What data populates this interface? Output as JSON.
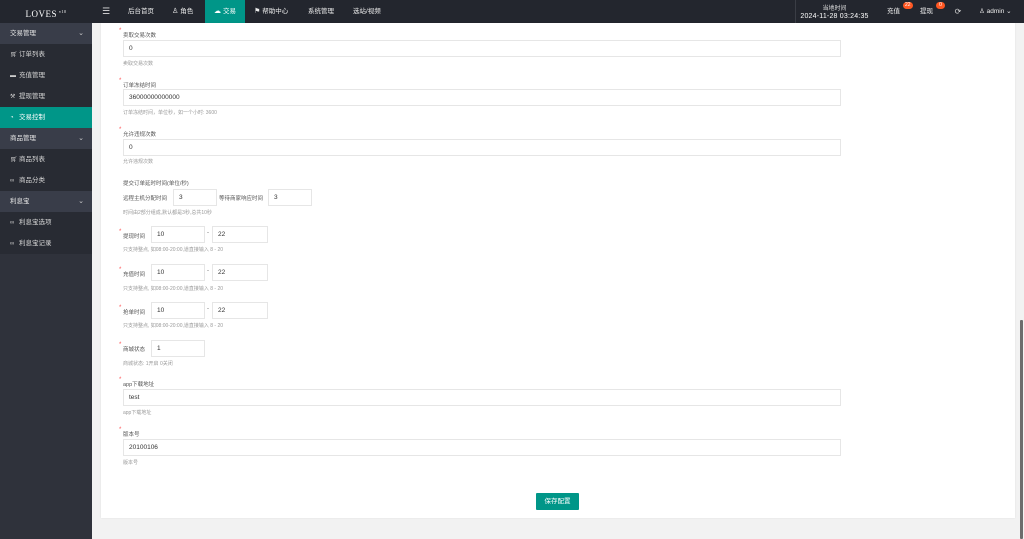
{
  "app": {
    "logo": "LOVES",
    "logo_sup": "v10"
  },
  "topnav": [
    {
      "label": "后台首页",
      "icon": ""
    },
    {
      "label": "角色",
      "icon": "user-icon"
    },
    {
      "label": "交易",
      "icon": "cloud-icon",
      "active": true
    },
    {
      "label": "帮助中心",
      "icon": "flag-icon"
    },
    {
      "label": "系统管理",
      "icon": ""
    },
    {
      "label": "选站/视频",
      "icon": ""
    }
  ],
  "header": {
    "time_label": "当地时间",
    "time_value": "2024-11-28 03:24:35",
    "recharge_label": "充值",
    "recharge_badge": "22",
    "withdraw_label": "提现",
    "withdraw_badge": "0",
    "user_label": "admin"
  },
  "sidebar": {
    "groups": [
      {
        "label": "交易管理",
        "items": [
          {
            "label": "订单列表",
            "icon": "cart-icon"
          },
          {
            "label": "充值管理",
            "icon": "chat-icon"
          },
          {
            "label": "提现管理",
            "icon": "hammer-icon"
          },
          {
            "label": "交易控制",
            "icon": "gauge-icon",
            "active": true
          }
        ]
      },
      {
        "label": "商品管理",
        "items": [
          {
            "label": "商品列表",
            "icon": "cart-icon"
          },
          {
            "label": "商品分类",
            "icon": "link-icon"
          }
        ]
      },
      {
        "label": "利息宝",
        "items": [
          {
            "label": "利息宝选项",
            "icon": "link-icon"
          },
          {
            "label": "利息宝记录",
            "icon": "link-icon"
          }
        ]
      }
    ]
  },
  "form": {
    "f1": {
      "label": "卖取交易次数",
      "value": "0",
      "help": "卖取交易次数"
    },
    "f2": {
      "label": "订单冻结时间",
      "value": "36000000000000",
      "help": "订单冻结时间，单位秒，如一个小时: 3600"
    },
    "f3": {
      "label": "允许违规次数",
      "value": "0",
      "help": "允许违规次数"
    },
    "f4": {
      "label": "提交订单延时时间(单位/秒)",
      "a_label": "远程主机分配时间",
      "a_value": "3",
      "b_label": "等待商家响应时间",
      "b_value": "3",
      "help": "时间由2部分组成,默认都是3秒,总共10秒"
    },
    "f5": {
      "label": "提现时间",
      "from": "10",
      "to": "22",
      "help": "只支持整点, 如08:00-20:00,道直接输入 8 - 20"
    },
    "f6": {
      "label": "充值时间",
      "from": "10",
      "to": "22",
      "help": "只支持整点, 如08:00-20:00,道直接输入 8 - 20"
    },
    "f7": {
      "label": "抢单时间",
      "from": "10",
      "to": "22",
      "help": "只支持整点, 如08:00-20:00,道直接输入 8 - 20"
    },
    "f8": {
      "label": "商城状态",
      "value": "1",
      "help": "商城状态: 1开启 0关闭"
    },
    "f9": {
      "label": "app下载地址",
      "value": "test",
      "help": "app下载地址"
    },
    "f10": {
      "label": "版本号",
      "value": "20100106",
      "help": "版本号"
    },
    "dash": "-",
    "required_mark": "*",
    "save_label": "保存配置"
  }
}
